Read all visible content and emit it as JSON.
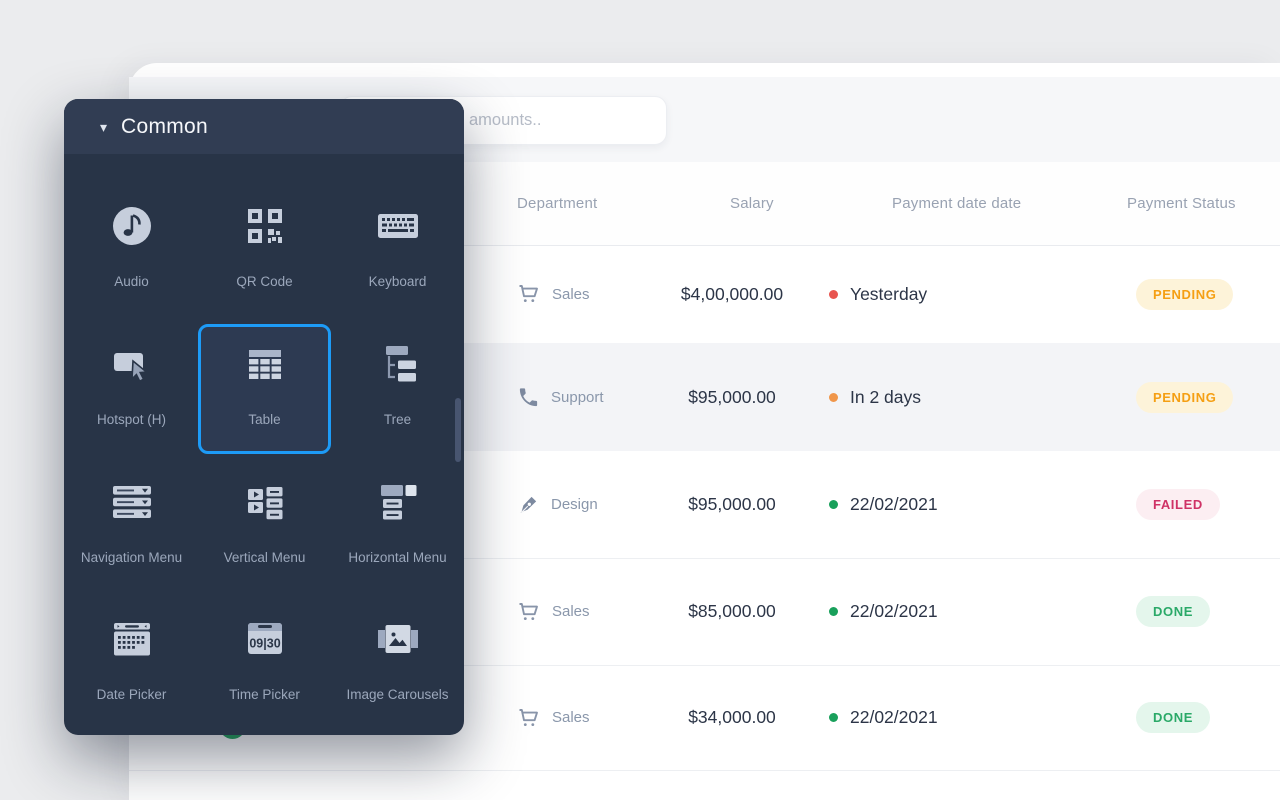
{
  "search": {
    "placeholder": "amounts.."
  },
  "panel": {
    "title": "Common",
    "items": [
      {
        "label": "Audio"
      },
      {
        "label": "QR Code"
      },
      {
        "label": "Keyboard"
      },
      {
        "label": "Hotspot (H)"
      },
      {
        "label": "Table",
        "selected": true
      },
      {
        "label": "Tree"
      },
      {
        "label": "Navigation Menu"
      },
      {
        "label": "Vertical Menu"
      },
      {
        "label": "Horizontal Menu"
      },
      {
        "label": "Date Picker"
      },
      {
        "label": "Time Picker",
        "icon_text": "09|30"
      },
      {
        "label": "Image Carousels"
      }
    ]
  },
  "table": {
    "columns": [
      "Department",
      "Salary",
      "Payment date date",
      "Payment Status"
    ],
    "rows": [
      {
        "department": "Sales",
        "salary": "$4,00,000.00",
        "payment_date": "Yesterday",
        "dot": "red",
        "status": "PENDING"
      },
      {
        "department": "Support",
        "salary": "$95,000.00",
        "payment_date": "In 2 days",
        "dot": "orange",
        "status": "PENDING"
      },
      {
        "department": "Design",
        "salary": "$95,000.00",
        "payment_date": "22/02/2021",
        "dot": "green",
        "status": "FAILED"
      },
      {
        "department": "Sales",
        "salary": "$85,000.00",
        "payment_date": "22/02/2021",
        "dot": "green",
        "status": "DONE"
      },
      {
        "department": "Sales",
        "salary": "$34,000.00",
        "payment_date": "22/02/2021",
        "dot": "green",
        "status": "DONE"
      }
    ]
  },
  "colors": {
    "accent_blue": "#1d9bf7",
    "panel_bg": "#283447",
    "panel_header_bg": "#313d53",
    "status_pending_fg": "#f59f13",
    "status_pending_bg": "#fdf3d9",
    "status_failed_fg": "#cf3266",
    "status_failed_bg": "#fceef2",
    "status_done_fg": "#2aa968",
    "status_done_bg": "#e4f6ec",
    "dot_red": "#e8554f",
    "dot_orange": "#f0964a",
    "dot_green": "#19a05b",
    "avatar_green": "#27a45f"
  }
}
